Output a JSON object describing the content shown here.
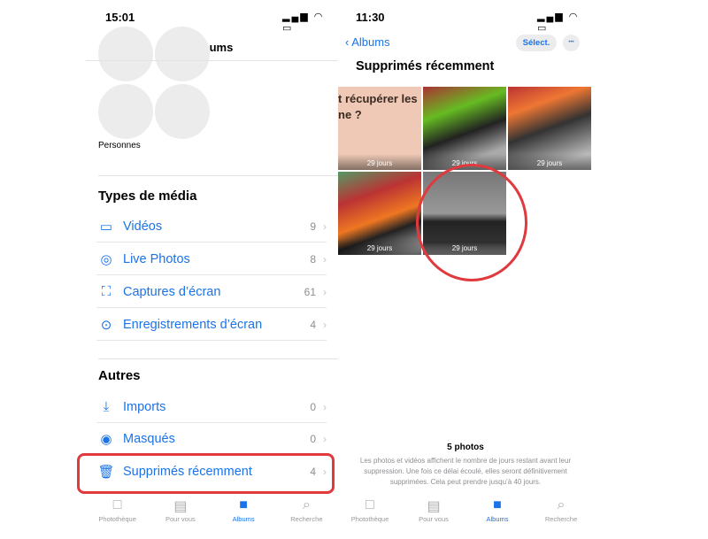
{
  "left": {
    "time": "15:01",
    "header": {
      "title": "Albums",
      "add": "+"
    },
    "people_label": "Personnes",
    "media_section": "Types de média",
    "media_items": [
      {
        "label": "Vidéos",
        "count": "9",
        "icon": "video-icon"
      },
      {
        "label": "Live Photos",
        "count": "8",
        "icon": "live-photo-icon"
      },
      {
        "label": "Captures d’écran",
        "count": "61",
        "icon": "screenshot-icon"
      },
      {
        "label": "Enregistrements d’écran",
        "count": "4",
        "icon": "screen-record-icon"
      }
    ],
    "other_section": "Autres",
    "other_items": [
      {
        "label": "Imports",
        "count": "0",
        "icon": "import-icon"
      },
      {
        "label": "Masqués",
        "count": "0",
        "icon": "eye-slash-icon"
      },
      {
        "label": "Supprimés récemment",
        "count": "4",
        "icon": "trash-icon"
      }
    ]
  },
  "right": {
    "time": "11:30",
    "back_label": "Albums",
    "select_label": "Sélect.",
    "more_label": "•••",
    "title": "Supprimés récemment",
    "photo_text": "t récupérer les pl\nne ?",
    "photos": [
      {
        "days": "29 jours"
      },
      {
        "days": "29 jours"
      },
      {
        "days": "29 jours"
      },
      {
        "days": "29 jours"
      },
      {
        "days": "29 jours"
      }
    ],
    "count": "5 photos",
    "note": "Les photos et vidéos affichent le nombre de jours restant avant leur suppression. Une fois ce délai écoulé, elles seront définitivement supprimées. Cela peut prendre jusqu’à 40 jours."
  },
  "tabs": [
    {
      "label": "Photothèque",
      "icon": "□"
    },
    {
      "label": "Pour vous",
      "icon": "▤"
    },
    {
      "label": "Albums",
      "icon": "■"
    },
    {
      "label": "Recherche",
      "icon": "⌕"
    }
  ],
  "colors": {
    "accent": "#1a73e8",
    "highlight": "#e0393e"
  }
}
